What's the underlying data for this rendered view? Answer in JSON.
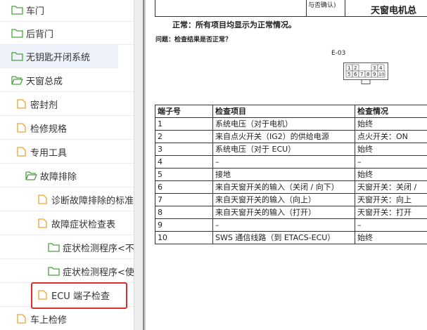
{
  "tree": {
    "items": [
      {
        "label": "车门",
        "icon": "folder-icon"
      },
      {
        "label": "后背门",
        "icon": "folder-icon"
      },
      {
        "label": "无钥匙开闭系统",
        "icon": "folder-icon"
      },
      {
        "label": "天窗总成",
        "icon": "folder-open-icon"
      },
      {
        "label": "密封剂",
        "icon": "document-icon"
      },
      {
        "label": "检修规格",
        "icon": "document-icon"
      },
      {
        "label": "专用工具",
        "icon": "document-icon"
      },
      {
        "label": "故障排除",
        "icon": "folder-open-icon"
      },
      {
        "label": "诊断故障排除的标准",
        "icon": "document-icon"
      },
      {
        "label": "故障症状检查表",
        "icon": "document-icon"
      },
      {
        "label": "症状检测程序<不",
        "icon": "folder-icon"
      },
      {
        "label": "症状检测程序<使",
        "icon": "folder-icon"
      },
      {
        "label": "ECU 端子检查",
        "icon": "document-icon"
      },
      {
        "label": "车上检修",
        "icon": "document-icon"
      }
    ]
  },
  "doc": {
    "top_row_fragment": "与否确认)",
    "top_title": "天窗电机总",
    "normal_text": "正常：所有项目均显示为正常情况。",
    "question_text": "问题：检查结果是否正常？",
    "connector_id": "E-03",
    "connector_pins_top": [
      "1",
      "2",
      "",
      "3",
      "4"
    ],
    "connector_pins_bottom": [
      "5",
      "6",
      "7",
      "8",
      "9",
      "10"
    ],
    "table": {
      "headers": [
        "端子号",
        "检查项目",
        "检查情况"
      ],
      "rows": [
        [
          "1",
          "系统电压（对于电机）",
          "始终"
        ],
        [
          "2",
          "来自点火开关（IG2）的供给电源",
          "点火开关：ON"
        ],
        [
          "3",
          "系统电压（对于 ECU）",
          "始终"
        ],
        [
          "4",
          "–",
          "–"
        ],
        [
          "5",
          "接地",
          "始终"
        ],
        [
          "6",
          "来自天窗开关的输入（关闭 / 向下）",
          "天窗开关：关闭 /"
        ],
        [
          "7",
          "来自天窗开关的输入（向上）",
          "天窗开关：向上"
        ],
        [
          "8",
          "来自天窗开关的输入（打开）",
          "天窗开关：打开"
        ],
        [
          "9",
          "–",
          "–"
        ],
        [
          "10",
          "SWS 通信线路（到 ETACS-ECU）",
          "始终"
        ]
      ]
    }
  },
  "colors": {
    "folder_closed": "#4aa03c",
    "folder_open": "#4aa03c",
    "document": "#f0a030",
    "selection_border": "#d9302c",
    "highlight_row": "#eef3fb"
  }
}
